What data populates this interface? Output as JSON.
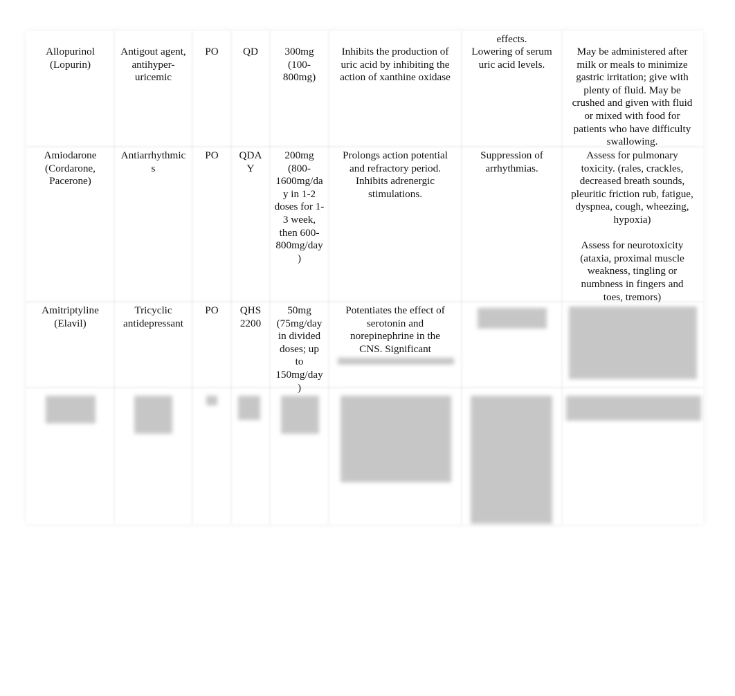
{
  "carryover": {
    "effects_tail": "effects."
  },
  "rows": [
    {
      "drug": "Allopurinol\n(Lopurin)",
      "class": "Antigout agent,\nantihyper-\nuricemic",
      "route": "PO",
      "freq": "QD",
      "dose": "300mg\n(100-\n800mg)",
      "action": "Inhibits the production of\nuric acid by inhibiting the\naction of xanthine oxidase",
      "effect": "Lowering of serum\nuric acid levels.",
      "nursing": "May be administered after\nmilk or meals to minimize\ngastric irritation; give with\nplenty of fluid. May be\ncrushed and given with fluid\nor mixed with food for\npatients who have difficulty\nswallowing."
    },
    {
      "drug": "Amiodarone\n(Cordarone,\nPacerone)",
      "class": "Antiarrhythmic\ns",
      "route": "PO",
      "freq": "QDA\nY",
      "dose": "200mg\n(800-\n1600mg/da\ny in 1-2\ndoses for 1-\n3 week,\nthen 600-\n800mg/day\n)",
      "action": "Prolongs action potential\nand refractory period.\nInhibits adrenergic\nstimulations.",
      "effect": "Suppression of\narrhythmias.",
      "nursing": "Assess for pulmonary\ntoxicity. (rales, crackles,\ndecreased breath sounds,\npleuritic friction rub, fatigue,\ndyspnea, cough, wheezing,\nhypoxia)\n\nAssess for neurotoxicity\n(ataxia, proximal muscle\nweakness, tingling or\nnumbness in fingers and\ntoes, tremors)"
    },
    {
      "drug": "Amitriptyline\n(Elavil)",
      "class": "Tricyclic\nantidepressant",
      "route": "PO",
      "freq": "QHS\n2200",
      "dose": "50mg\n(75mg/day\nin divided\ndoses; up\nto\n150mg/day\n)",
      "action": "Potentiates the effect of\nserotonin and\nnorepinephrine in the\nCNS. Significant",
      "effect": "",
      "nursing": ""
    }
  ]
}
